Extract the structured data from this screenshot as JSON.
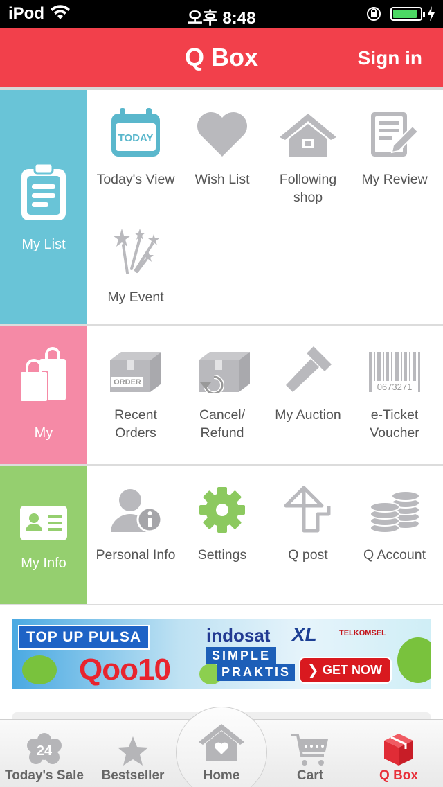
{
  "status_bar": {
    "carrier": "iPod",
    "time": "오후 8:48",
    "battery_level": 0.9
  },
  "header": {
    "title": "Q Box",
    "sign_in": "Sign in"
  },
  "sections": [
    {
      "label": "My List",
      "icon": "clipboard-icon",
      "items": [
        {
          "label": "Today's View",
          "icon": "calendar-today-icon",
          "icon_text": "TODAY"
        },
        {
          "label": "Wish List",
          "icon": "heart-icon"
        },
        {
          "label": "Following shop",
          "icon": "shop-house-icon"
        },
        {
          "label": "My Review",
          "icon": "review-pencil-icon"
        },
        {
          "label": "My Event",
          "icon": "fireworks-icon"
        }
      ]
    },
    {
      "label": "My",
      "icon": "shopping-bags-icon",
      "items": [
        {
          "label": "Recent Orders",
          "icon": "order-box-icon",
          "icon_text": "ORDER"
        },
        {
          "label": "Cancel/ Refund",
          "icon": "refund-box-icon"
        },
        {
          "label": "My Auction",
          "icon": "gavel-icon"
        },
        {
          "label": "e-Ticket Voucher",
          "icon": "barcode-icon",
          "icon_text": "0673271"
        }
      ]
    },
    {
      "label": "My Info",
      "icon": "id-card-icon",
      "items": [
        {
          "label": "Personal Info",
          "icon": "person-info-icon"
        },
        {
          "label": "Settings",
          "icon": "gear-icon"
        },
        {
          "label": "Q post",
          "icon": "qpost-icon"
        },
        {
          "label": "Q Account",
          "icon": "coins-icon"
        }
      ]
    }
  ],
  "banner": {
    "top_up": "TOP UP PULSA",
    "brand": "Qoo10",
    "operator1": "indosat",
    "simple": "SIMPLE",
    "praktis": "PRAKTIS",
    "operator2": "XL",
    "operator3": "TELKOMSEL",
    "cta": "GET NOW"
  },
  "tabbar": [
    {
      "label": "Today's Sale",
      "icon": "flower-badge-icon",
      "badge": "24",
      "active": false
    },
    {
      "label": "Bestseller",
      "icon": "star-icon",
      "active": false
    },
    {
      "label": "Home",
      "icon": "home-heart-icon",
      "active": false
    },
    {
      "label": "Cart",
      "icon": "cart-icon",
      "active": false
    },
    {
      "label": "Q Box",
      "icon": "qbox-cube-icon",
      "active": true
    }
  ],
  "colors": {
    "header": "#f2404b",
    "my_list": "#69c4d7",
    "my": "#f58aa6",
    "my_info": "#95cf6f",
    "icon_gray": "#b9b9bd",
    "active_tab": "#e8303a"
  }
}
